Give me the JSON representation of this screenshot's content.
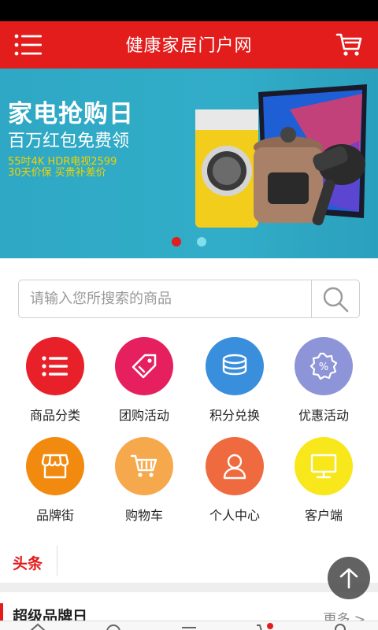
{
  "header": {
    "title": "健康家居门户网"
  },
  "banner": {
    "headline": "家电抢购日",
    "subline": "百万红包免费领",
    "promo_line1": "55吋4K HDR电视2599",
    "promo_line2": "30天价保 买贵补差价"
  },
  "search": {
    "placeholder": "请输入您所搜索的商品"
  },
  "categories": [
    {
      "label": "商品分类",
      "color": "#e8202a",
      "icon": "list-icon"
    },
    {
      "label": "团购活动",
      "color": "#e6205f",
      "icon": "tag-icon"
    },
    {
      "label": "积分兑换",
      "color": "#3a8fdc",
      "icon": "coins-icon"
    },
    {
      "label": "优惠活动",
      "color": "#8d95d8",
      "icon": "discount-icon"
    },
    {
      "label": "品牌街",
      "color": "#f28a0f",
      "icon": "store-icon"
    },
    {
      "label": "购物车",
      "color": "#f6a94c",
      "icon": "cart-icon"
    },
    {
      "label": "个人中心",
      "color": "#ef6a3e",
      "icon": "user-icon"
    },
    {
      "label": "客户端",
      "color": "#f7e71b",
      "icon": "monitor-icon"
    }
  ],
  "headlines": {
    "tag": "头条"
  },
  "section": {
    "title": "超级品牌日",
    "more": "更多 >"
  },
  "colors": {
    "brand_red": "#e31c1c",
    "banner_teal": "#2ea8c4"
  }
}
